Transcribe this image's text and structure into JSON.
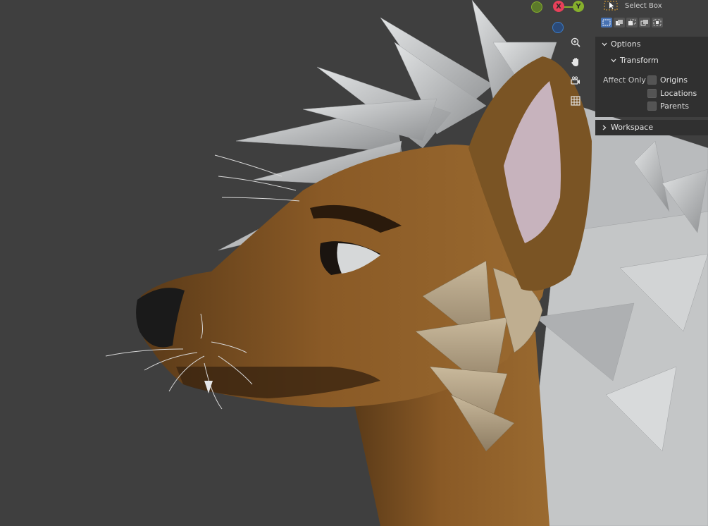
{
  "toolbar": {
    "select_box_label": "Select Box",
    "select_box_icon": "select-box-icon",
    "mode_icons": [
      "mode-set-icon",
      "mode-extend-icon",
      "mode-subtract-icon",
      "mode-difference-icon",
      "mode-intersect-icon"
    ]
  },
  "gizmo": {
    "x_label": "X",
    "y_label": "Y",
    "x_color": "#e8405a",
    "y_color": "#86b02c",
    "z_color": "#3b7ecb"
  },
  "nav_icons": [
    "zoom-icon",
    "pan-hand-icon",
    "camera-view-icon",
    "perspective-grid-icon"
  ],
  "options": {
    "title": "Options",
    "transform": {
      "title": "Transform",
      "affect_only_label": "Affect Only",
      "items": [
        {
          "label": "Origins",
          "checked": false
        },
        {
          "label": "Locations",
          "checked": false
        },
        {
          "label": "Parents",
          "checked": false
        }
      ]
    }
  },
  "workspace": {
    "title": "Workspace"
  },
  "colors": {
    "viewport_bg": "#3f3f3f",
    "panel_bg": "#303030",
    "fur": "#8a5a26",
    "fur_dark": "#3a2410",
    "spikes": "#c9cbcc",
    "ear_inner": "#c7b3bd",
    "accent_select": "#4772b3"
  }
}
